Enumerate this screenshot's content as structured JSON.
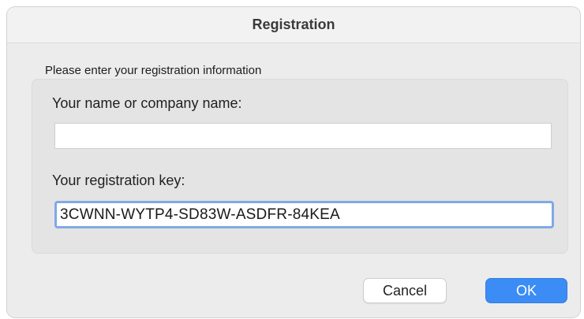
{
  "window": {
    "title": "Registration"
  },
  "form": {
    "intro": "Please enter your registration information",
    "name_label": "Your name or company name:",
    "name_value": "",
    "key_label": "Your registration key:",
    "key_value": "3CWNN-WYTP4-SD83W-ASDFR-84KEA"
  },
  "buttons": {
    "cancel_label": "Cancel",
    "ok_label": "OK"
  },
  "colors": {
    "accent": "#3b8cf5",
    "focus_ring": "#7fa9e6"
  }
}
